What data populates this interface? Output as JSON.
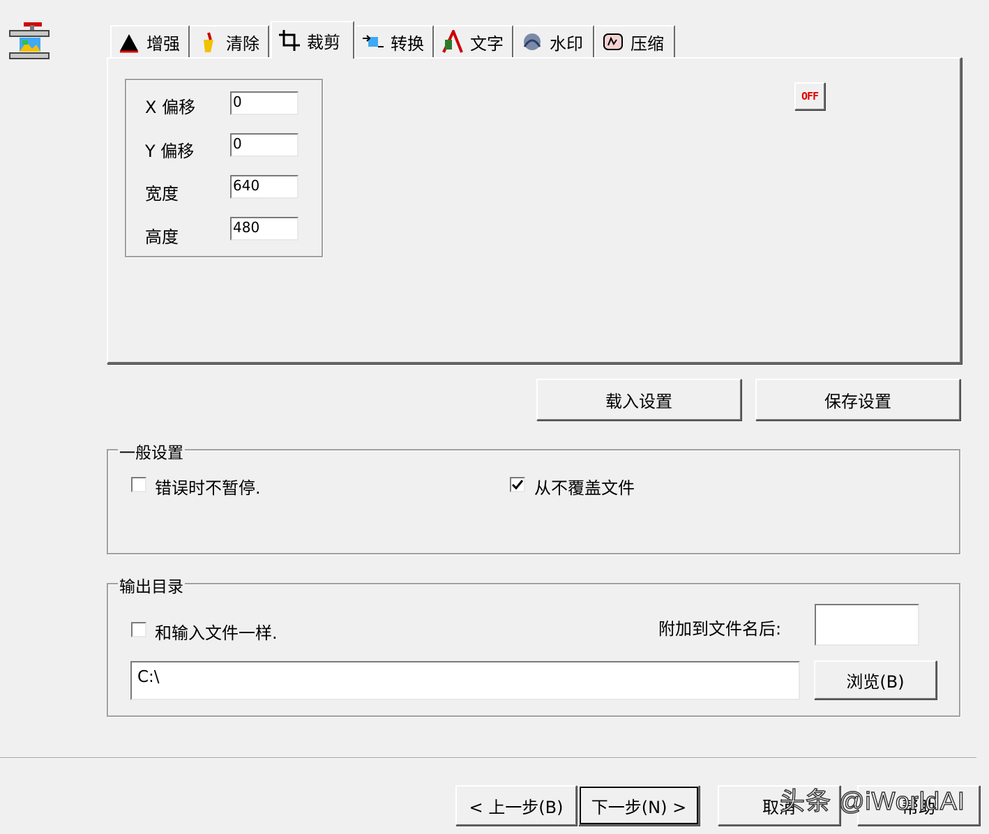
{
  "tabs": [
    {
      "label": "增强",
      "icon": "enhance-icon"
    },
    {
      "label": "清除",
      "icon": "clear-icon"
    },
    {
      "label": "裁剪",
      "icon": "crop-icon"
    },
    {
      "label": "转换",
      "icon": "convert-icon"
    },
    {
      "label": "文字",
      "icon": "text-icon"
    },
    {
      "label": "水印",
      "icon": "watermark-icon"
    },
    {
      "label": "压缩",
      "icon": "compress-icon"
    }
  ],
  "active_tab": "裁剪",
  "crop": {
    "x_label": "X 偏移",
    "x_value": "0",
    "y_label": "Y 偏移",
    "y_value": "0",
    "width_label": "宽度",
    "width_value": "640",
    "height_label": "高度",
    "height_value": "480"
  },
  "toggle": {
    "label": "OFF"
  },
  "settings_buttons": {
    "load": "载入设置",
    "save": "保存设置"
  },
  "general": {
    "title": "一般设置",
    "no_pause_label": "错误时不暂停.",
    "no_pause_checked": false,
    "never_overwrite_label": "从不覆盖文件",
    "never_overwrite_checked": true
  },
  "output": {
    "title": "输出目录",
    "same_as_input_label": "和输入文件一样.",
    "same_as_input_checked": false,
    "suffix_label": "附加到文件名后:",
    "suffix_value": "",
    "path_value": "C:\\",
    "browse_label": "浏览(B)"
  },
  "footer": {
    "prev": "< 上一步(B)",
    "next": "下一步(N) >",
    "cancel": "取消",
    "help": "帮助"
  },
  "watermark_text": "头条 @iWorldAI"
}
